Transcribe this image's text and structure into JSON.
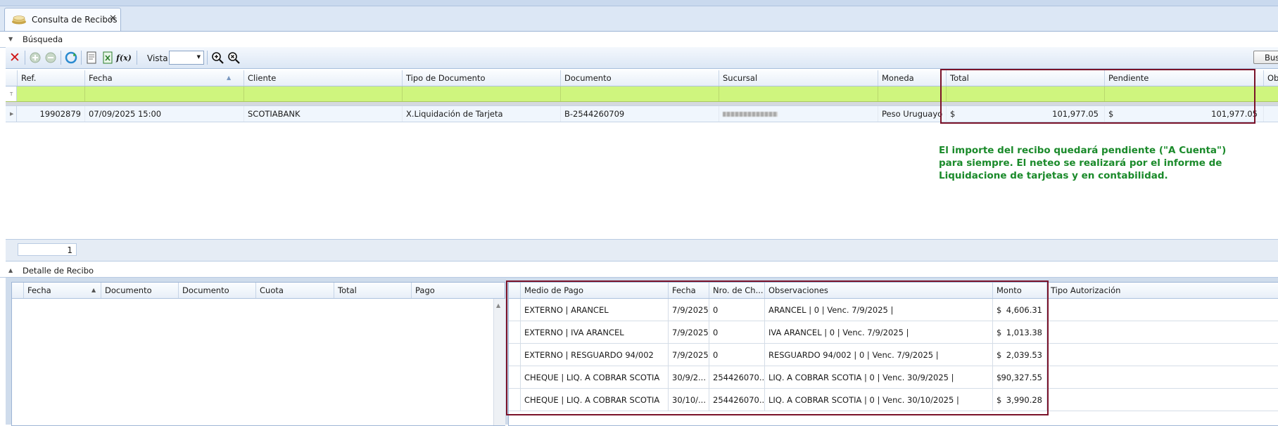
{
  "tab": {
    "title": "Consulta de Recibos",
    "close": "✕"
  },
  "busqueda": {
    "title": "Búsqueda"
  },
  "toolbar": {
    "vista_label": "Vista",
    "vista_value": "",
    "buscar_label": "Busca"
  },
  "grid": {
    "columns": [
      "Ref.",
      "Fecha",
      "Cliente",
      "Tipo de Documento",
      "Documento",
      "Sucursal",
      "Moneda",
      "Total",
      "Pendiente",
      "Obse"
    ],
    "row": {
      "ref": "19902879",
      "fecha": "07/09/2025 15:00",
      "cliente": "SCOTIABANK",
      "tipo": "X.Liquidación de Tarjeta",
      "documento": "B-2544260709",
      "sucursal": "",
      "moneda": "Peso Uruguayo",
      "total_cur": "$",
      "total": "101,977.05",
      "pend_cur": "$",
      "pendiente": "101,977.05"
    }
  },
  "annotation": "El importe del recibo quedará pendiente (\"A Cuenta\") para siempre. El neteo se realizará por el informe de Liquidacione de tarjetas y en contabilidad.",
  "pager": {
    "value": "1"
  },
  "detalle": {
    "title": "Detalle de Recibo",
    "left_columns": [
      "Fecha",
      "Documento",
      "Documento",
      "Cuota",
      "Total",
      "Pago"
    ],
    "right_columns": [
      "Medio de Pago",
      "Fecha",
      "Nro. de Ch...",
      "Observaciones",
      "Monto",
      "Tipo Autorización"
    ],
    "rows": [
      {
        "medio": "EXTERNO | ARANCEL",
        "fecha": "7/9/2025",
        "nro": "0",
        "obs": "ARANCEL | 0  | Venc. 7/9/2025 |",
        "cur": "$",
        "monto": "4,606.31"
      },
      {
        "medio": "EXTERNO | IVA ARANCEL",
        "fecha": "7/9/2025",
        "nro": "0",
        "obs": "IVA ARANCEL | 0  | Venc. 7/9/2025 |",
        "cur": "$",
        "monto": "1,013.38"
      },
      {
        "medio": "EXTERNO | RESGUARDO 94/002",
        "fecha": "7/9/2025",
        "nro": "0",
        "obs": "RESGUARDO 94/002 | 0  | Venc. 7/9/2025 |",
        "cur": "$",
        "monto": "2,039.53"
      },
      {
        "medio": "CHEQUE | LIQ. A COBRAR SCOTIA",
        "fecha": "30/9/2...",
        "nro": "254426070...",
        "obs": "LIQ. A COBRAR SCOTIA | 0  | Venc. 30/9/2025 |",
        "cur": "$",
        "monto": "90,327.55"
      },
      {
        "medio": "CHEQUE | LIQ. A COBRAR SCOTIA",
        "fecha": "30/10/...",
        "nro": "254426070...",
        "obs": "LIQ. A COBRAR SCOTIA | 0  | Venc. 30/10/2025 |",
        "cur": "$",
        "monto": "3,990.28"
      }
    ]
  },
  "colors": {
    "accent_red": "#7a1229",
    "filter_green": "#cff57e",
    "annotation_green": "#1a8a2a"
  }
}
